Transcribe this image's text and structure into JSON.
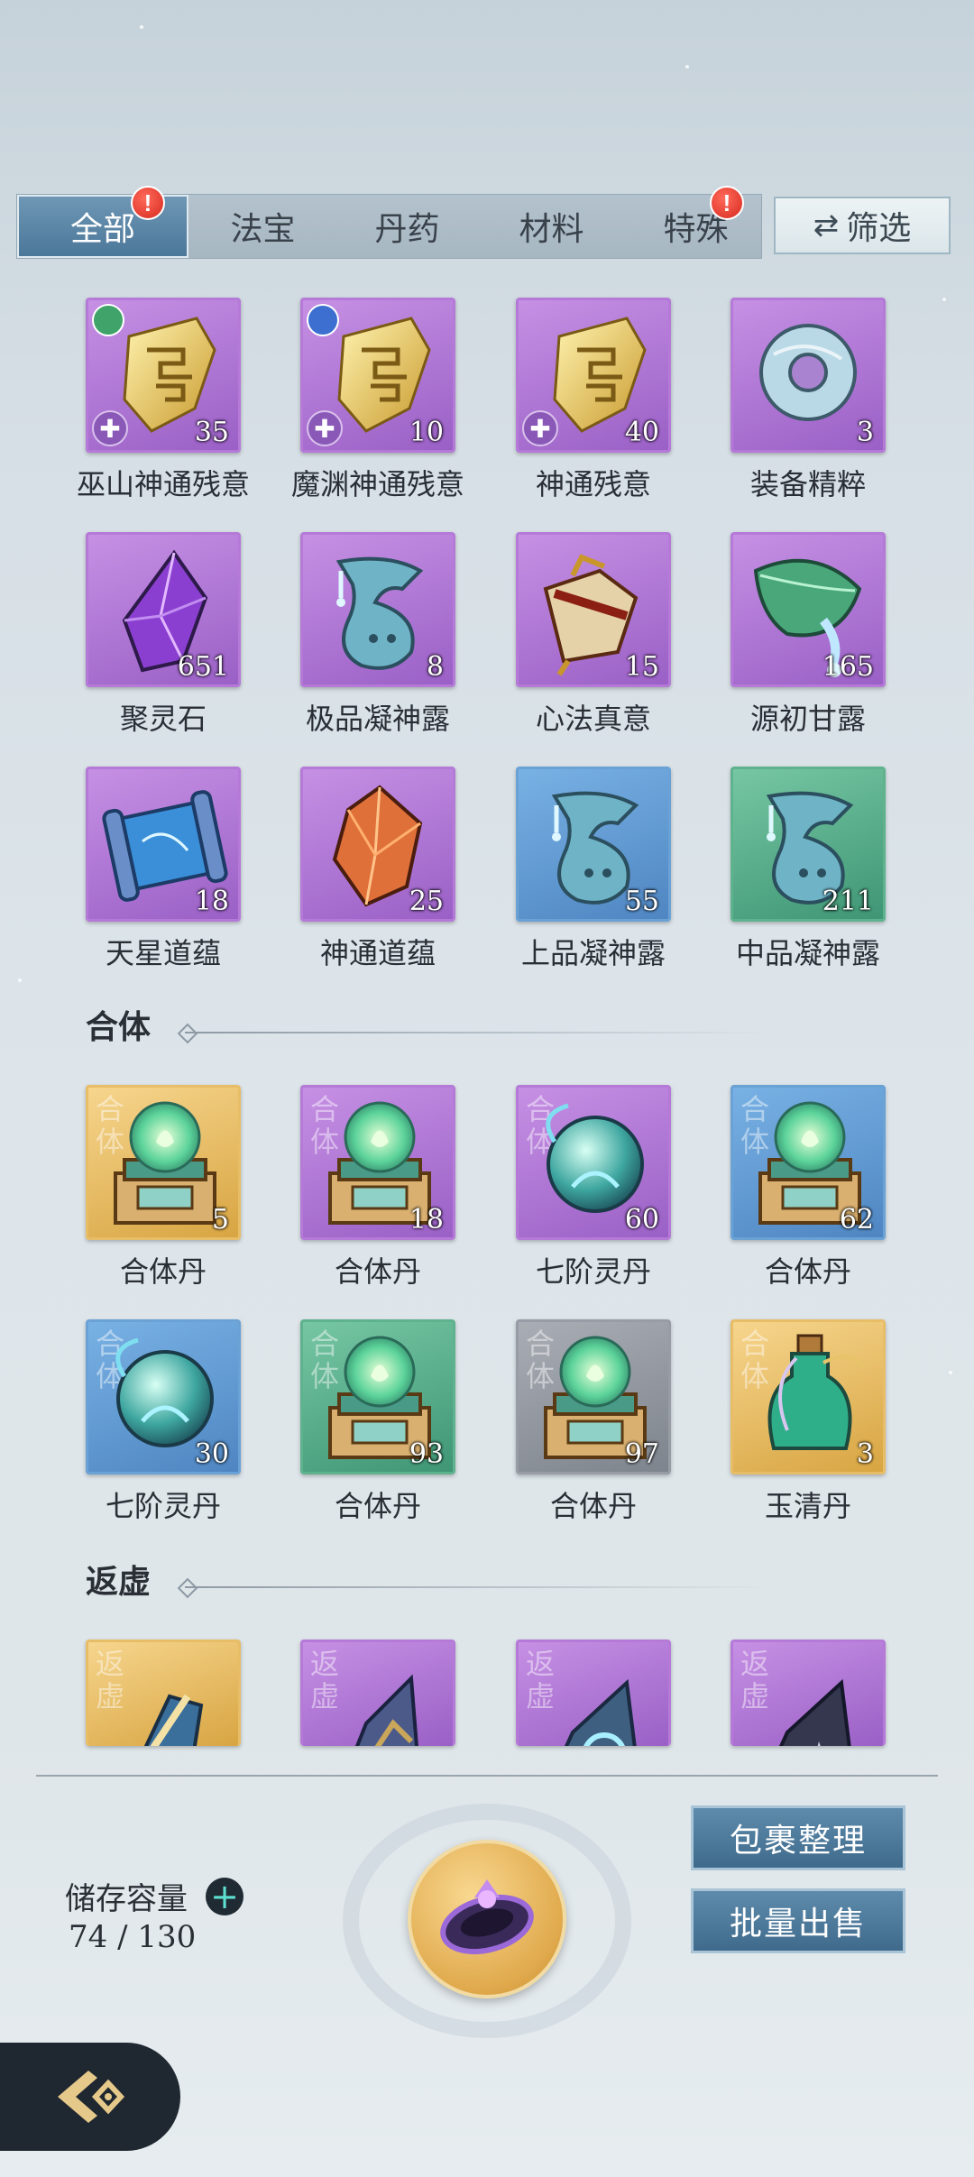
{
  "tabs": [
    {
      "label": "全部",
      "active": true,
      "alert": true
    },
    {
      "label": "法宝",
      "active": false,
      "alert": false
    },
    {
      "label": "丹药",
      "active": false,
      "alert": false
    },
    {
      "label": "材料",
      "active": false,
      "alert": false
    },
    {
      "label": "特殊",
      "active": false,
      "alert": true
    }
  ],
  "alert_mark": "!",
  "filter_label": "筛选",
  "items": [
    {
      "name": "巫山神通残意",
      "count": "35",
      "rarity": "purple",
      "icon": "golden-talisman-icon"
    },
    {
      "name": "魔渊神通残意",
      "count": "10",
      "rarity": "purple",
      "icon": "golden-talisman-icon"
    },
    {
      "name": "神通残意",
      "count": "40",
      "rarity": "purple",
      "icon": "golden-talisman-icon"
    },
    {
      "name": "装备精粹",
      "count": "3",
      "rarity": "purple",
      "icon": "jade-ring-icon"
    },
    {
      "name": "聚灵石",
      "count": "651",
      "rarity": "purple",
      "icon": "purple-crystal-icon"
    },
    {
      "name": "极品凝神露",
      "count": "8",
      "rarity": "purple",
      "icon": "spirit-flask-icon"
    },
    {
      "name": "心法真意",
      "count": "15",
      "rarity": "purple",
      "icon": "scroll-artifact-icon"
    },
    {
      "name": "源初甘露",
      "count": "165",
      "rarity": "purple",
      "icon": "dew-leaf-icon"
    },
    {
      "name": "天星道蕴",
      "count": "18",
      "rarity": "purple",
      "icon": "star-scroll-icon"
    },
    {
      "name": "神通道蕴",
      "count": "25",
      "rarity": "purple",
      "icon": "amber-crystal-icon"
    },
    {
      "name": "上品凝神露",
      "count": "55",
      "rarity": "blue",
      "icon": "spirit-flask-icon"
    },
    {
      "name": "中品凝神露",
      "count": "211",
      "rarity": "green",
      "icon": "spirit-flask-icon"
    }
  ],
  "sections": [
    {
      "title": "合体",
      "items": [
        {
          "name": "合体丹",
          "count": "5",
          "rarity": "gold",
          "icon": "flame-orb-pill-icon",
          "tag": "合体"
        },
        {
          "name": "合体丹",
          "count": "18",
          "rarity": "purple",
          "icon": "flame-orb-pill-icon",
          "tag": "合体"
        },
        {
          "name": "七阶灵丹",
          "count": "60",
          "rarity": "purple",
          "icon": "blue-spirit-orb-icon",
          "tag": "合体"
        },
        {
          "name": "合体丹",
          "count": "62",
          "rarity": "blue",
          "icon": "flame-orb-pill-icon",
          "tag": "合体"
        },
        {
          "name": "七阶灵丹",
          "count": "30",
          "rarity": "blue",
          "icon": "blue-spirit-orb-icon",
          "tag": "合体"
        },
        {
          "name": "合体丹",
          "count": "93",
          "rarity": "green",
          "icon": "flame-orb-pill-icon",
          "tag": "合体"
        },
        {
          "name": "合体丹",
          "count": "97",
          "rarity": "gray",
          "icon": "flame-orb-pill-icon",
          "tag": "合体"
        },
        {
          "name": "玉清丹",
          "count": "3",
          "rarity": "gold",
          "icon": "green-potion-icon",
          "tag": "合体"
        }
      ]
    },
    {
      "title": "返虚",
      "items": [
        {
          "name": "",
          "count": "",
          "rarity": "gold",
          "icon": "sword-shard-icon",
          "tag": "返虚"
        },
        {
          "name": "",
          "count": "",
          "rarity": "purple",
          "icon": "armor-shard-icon",
          "tag": "返虚"
        },
        {
          "name": "",
          "count": "",
          "rarity": "purple",
          "icon": "swirl-shard-icon",
          "tag": "返虚"
        },
        {
          "name": "",
          "count": "",
          "rarity": "purple",
          "icon": "robe-shard-icon",
          "tag": "返虚"
        }
      ]
    }
  ],
  "storage": {
    "label": "储存容量",
    "plus": "+",
    "value": "74 / 130"
  },
  "buttons": {
    "organize": "包裹整理",
    "bulk_sell": "批量出售"
  },
  "colors": {
    "purple": "#b57ad8",
    "blue": "#6aa2d6",
    "green": "#5fb28e",
    "gold": "#e8bd68",
    "gray": "#989da5",
    "tab_active": "#5a86a8"
  }
}
